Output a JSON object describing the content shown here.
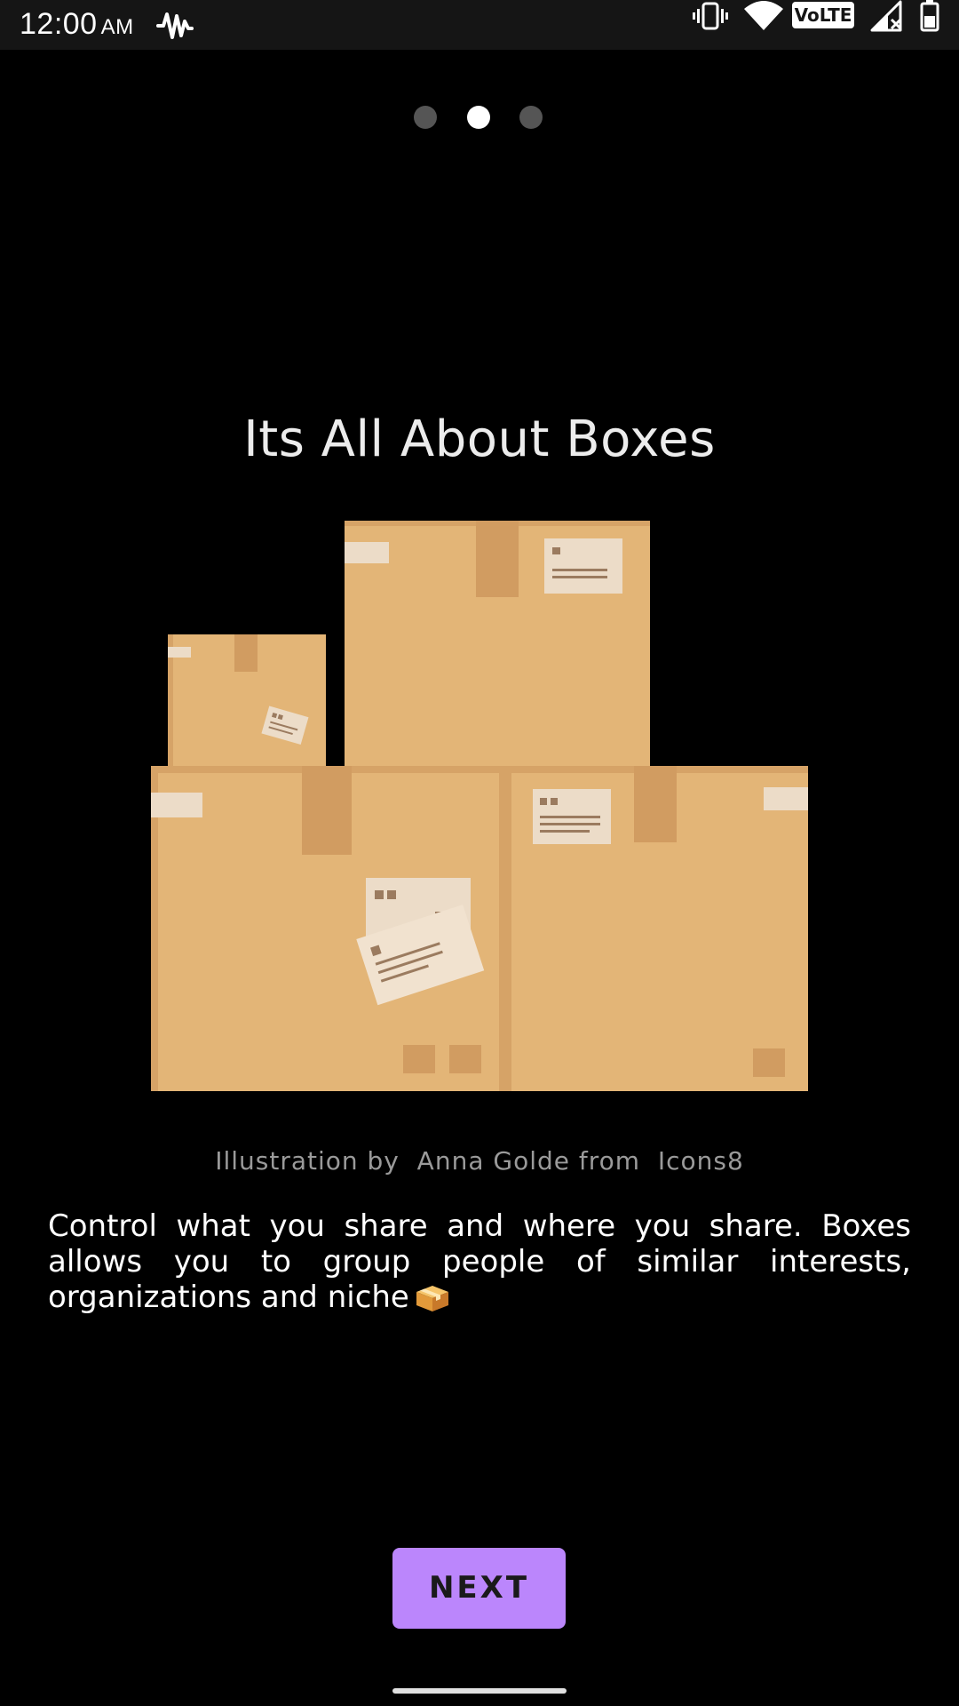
{
  "status_bar": {
    "time": "12:00",
    "ampm": "AM",
    "network_label": "VoLTE",
    "icons": [
      "activity-icon",
      "vibrate-icon",
      "wifi-icon",
      "volte-icon",
      "signal-icon",
      "battery-icon"
    ]
  },
  "pager": {
    "total": 3,
    "active_index": 1
  },
  "onboarding": {
    "title": "Its All About Boxes",
    "credit": "Illustration by  Anna Golde from  Icons8",
    "description": "Control what you share and where you share. Boxes allows you to group people of similar interests, organizations and niche",
    "description_emoji": "package-emoji"
  },
  "actions": {
    "next_label": "NEXT"
  },
  "colors": {
    "background": "#000000",
    "accent": "#bb86fc",
    "box": "#e3b577",
    "box_shadow": "#d6a367",
    "label": "#ecdcc8"
  }
}
